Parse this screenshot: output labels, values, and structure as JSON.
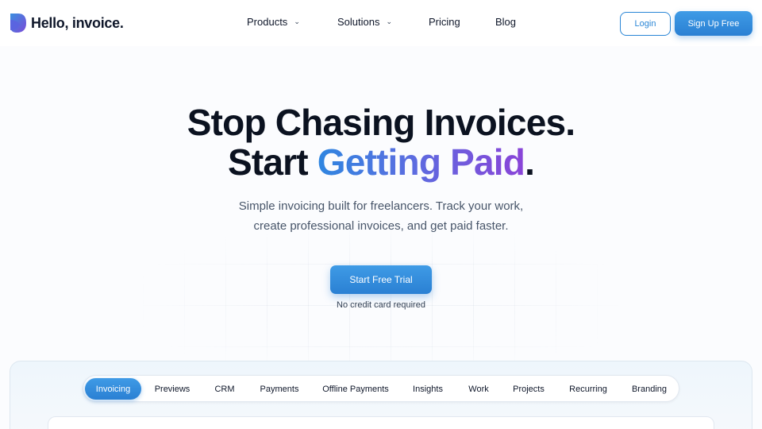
{
  "brand": {
    "name": "Hello, invoice.",
    "logo_icon": "hello-invoice-logo-icon"
  },
  "nav": {
    "products": "Products",
    "solutions": "Solutions",
    "pricing": "Pricing",
    "blog": "Blog",
    "chevron_icon": "chevron-down-icon"
  },
  "auth": {
    "login": "Login",
    "signup": "Sign Up Free"
  },
  "hero": {
    "line1": "Stop Chasing Invoices.",
    "line2_start": "Start ",
    "line2_highlight": "Getting Paid",
    "line2_end": ".",
    "subtitle_line1": "Simple invoicing built for freelancers. Track your work,",
    "subtitle_line2": "create professional invoices, and get paid faster.",
    "cta": "Start Free Trial",
    "note": "No credit card required"
  },
  "feature_tabs": {
    "active": "Invoicing",
    "items": [
      "Invoicing",
      "Previews",
      "CRM",
      "Payments",
      "Offline Payments",
      "Insights",
      "Work",
      "Projects",
      "Recurring",
      "Branding"
    ]
  },
  "colors": {
    "accent": "#2a86d6",
    "gradient_start": "#2f86e0",
    "gradient_end": "#8a44d8",
    "text": "#0f172a"
  }
}
